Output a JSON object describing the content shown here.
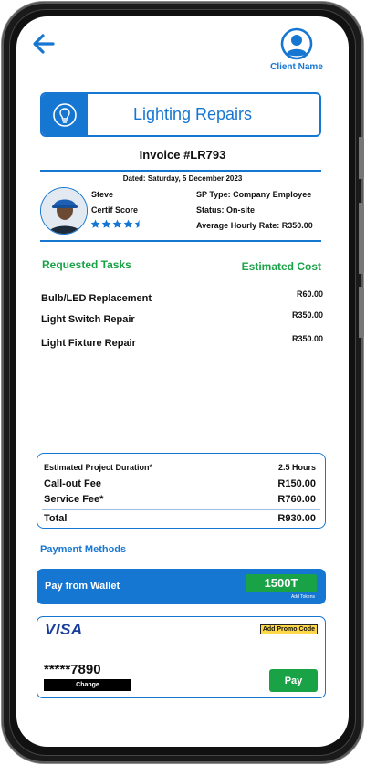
{
  "header": {
    "back_icon": "arrow-left-icon",
    "profile_icon": "user-circle-icon",
    "client_name": "Client Name"
  },
  "service": {
    "icon": "lightbulb-icon",
    "title": "Lighting Repairs"
  },
  "invoice": {
    "number": "Invoice #LR793",
    "dated": "Dated: Saturday, 5 December 2023"
  },
  "provider": {
    "name": "Steve",
    "certif_label": "Certif Score",
    "rating": 4.5,
    "rating_max": 5,
    "sp_type": "SP Type: Company Employee",
    "status": "Status: On-site",
    "avg_rate": "Average Hourly Rate: R350.00"
  },
  "tasks": {
    "header_left": "Requested Tasks",
    "header_right": "Estimated Cost",
    "items": [
      {
        "name": "Bulb/LED Replacement",
        "cost": "R60.00"
      },
      {
        "name": "Light Switch Repair",
        "cost": "R350.00"
      },
      {
        "name": "Light Fixture Repair",
        "cost": "R350.00"
      }
    ]
  },
  "summary": {
    "rows": [
      {
        "label": "Estimated Project Duration*",
        "value": "2.5 Hours"
      },
      {
        "label": "Call-out Fee",
        "value": "R150.00"
      },
      {
        "label": "Service Fee*",
        "value": "R760.00"
      },
      {
        "label": "Total",
        "value": "R930.00"
      }
    ]
  },
  "payment": {
    "title": "Payment Methods",
    "wallet_label": "Pay from Wallet",
    "wallet_tokens": "1500T",
    "add_tokens": "Add Tokens",
    "card_brand": "VISA",
    "promo_label": "Add Promo Code",
    "card_number": "*****7890",
    "change_label": "Change",
    "pay_label": "Pay"
  },
  "colors": {
    "primary": "#1677d2",
    "success": "#1aa247",
    "promo": "#ffd84a"
  }
}
